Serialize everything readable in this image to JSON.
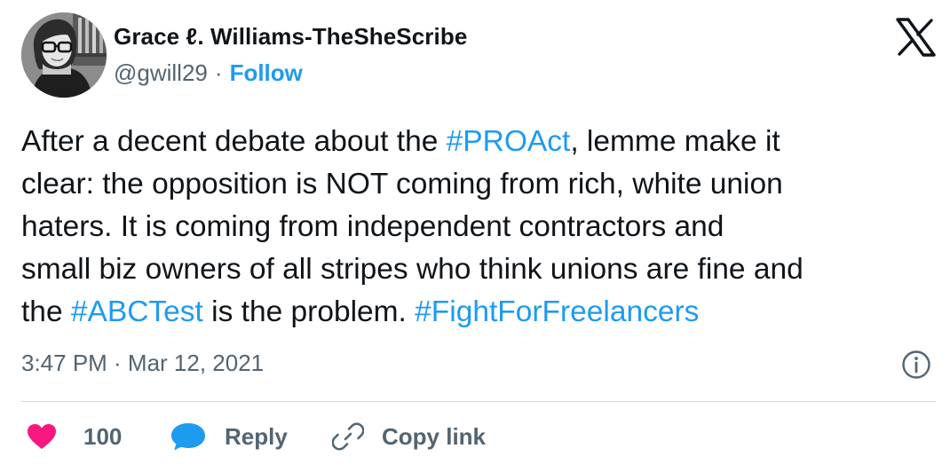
{
  "user": {
    "display_name": "Grace ℓ. Williams-TheSheScribe",
    "handle": "@gwill29",
    "separator": "·",
    "follow_label": "Follow"
  },
  "tweet": {
    "lines": [
      [
        {
          "text": "After a decent debate about the ",
          "type": "text"
        },
        {
          "text": "#PROAct",
          "type": "hashtag"
        },
        {
          "text": ", lemme make it",
          "type": "text"
        }
      ],
      [
        {
          "text": "clear: the opposition is NOT coming from rich, white union",
          "type": "text"
        }
      ],
      [
        {
          "text": "haters. It is coming from independent contractors and",
          "type": "text"
        }
      ],
      [
        {
          "text": "small biz owners of all stripes who think unions are fine and",
          "type": "text"
        }
      ],
      [
        {
          "text": "the ",
          "type": "text"
        },
        {
          "text": "#ABCTest",
          "type": "hashtag"
        },
        {
          "text": " is the problem. ",
          "type": "text"
        },
        {
          "text": "#FightForFreelancers",
          "type": "hashtag"
        }
      ]
    ],
    "timestamp": "3:47 PM · Mar 12, 2021"
  },
  "actions": {
    "like_count": "100",
    "reply_label": "Reply",
    "copy_link_label": "Copy link"
  },
  "icons": {
    "brand": "x-logo-icon",
    "info": "info-icon",
    "like": "heart-icon",
    "reply": "speech-bubble-icon",
    "copy_link": "link-icon"
  },
  "colors": {
    "text": "#0f1419",
    "secondary": "#536471",
    "link": "#1d9bf0",
    "like": "#f91880",
    "divider": "#cfd9de"
  }
}
